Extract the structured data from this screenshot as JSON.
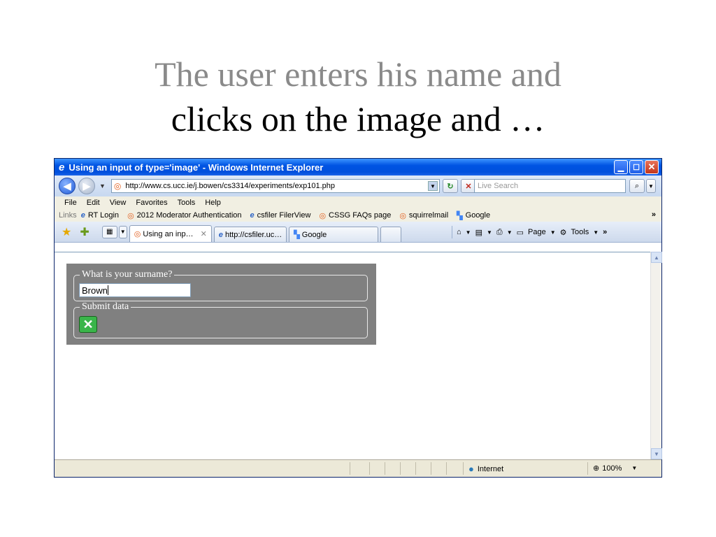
{
  "slide": {
    "title_line1": "The user enters his name and",
    "title_line2": "clicks on the image and …"
  },
  "window": {
    "title": "Using an input of type='image' - Windows Internet Explorer"
  },
  "address": {
    "url": "http://www.cs.ucc.ie/j.bowen/cs3314/experiments/exp101.php",
    "search_placeholder": "Live Search"
  },
  "menu": [
    "File",
    "Edit",
    "View",
    "Favorites",
    "Tools",
    "Help"
  ],
  "links": {
    "label": "Links",
    "items": [
      "RT Login",
      "2012 Moderator Authentication",
      "csfiler FilerView",
      "CSSG FAQs page",
      "squirrelmail",
      "Google"
    ]
  },
  "tabs": [
    "Using an inp…",
    "http://csfiler.uc…",
    "Google"
  ],
  "toolbar": {
    "page": "Page",
    "tools": "Tools"
  },
  "form": {
    "legend1": "What is your surname?",
    "surname_value": "Brown",
    "legend2": "Submit data"
  },
  "status": {
    "zone": "Internet",
    "zoom": "100%"
  },
  "colors": {
    "titlebar": "#0054e3",
    "form_panel": "#808080",
    "slide_title_gray": "#8a8a8a"
  }
}
